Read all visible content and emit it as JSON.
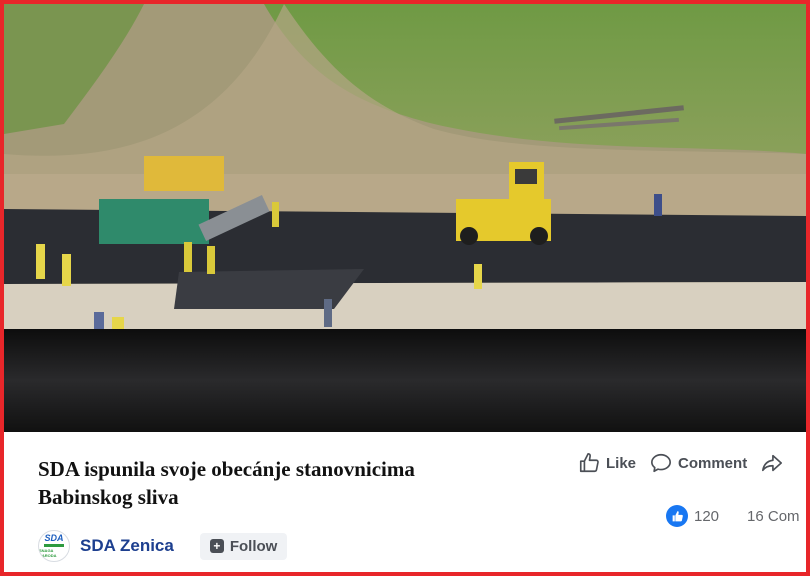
{
  "post": {
    "title_line1": "SDA ispunila svoje obecánje stanovnicima",
    "title_line2": "Babinskog sliva"
  },
  "actions": {
    "like": "Like",
    "comment": "Comment"
  },
  "stats": {
    "likes": "120",
    "comments": "16 Com"
  },
  "page": {
    "name": "SDA Zenica",
    "follow": "Follow",
    "logo_top": "SDA",
    "logo_bottom": "SNAGA NARODA"
  },
  "colors": {
    "frame": "#e8262a",
    "like_blue": "#1877f2",
    "page_name": "#1d3f8f"
  },
  "icons": [
    "thumbs-up-icon",
    "comment-icon",
    "share-icon",
    "like-reaction-icon",
    "follow-plus-icon"
  ]
}
